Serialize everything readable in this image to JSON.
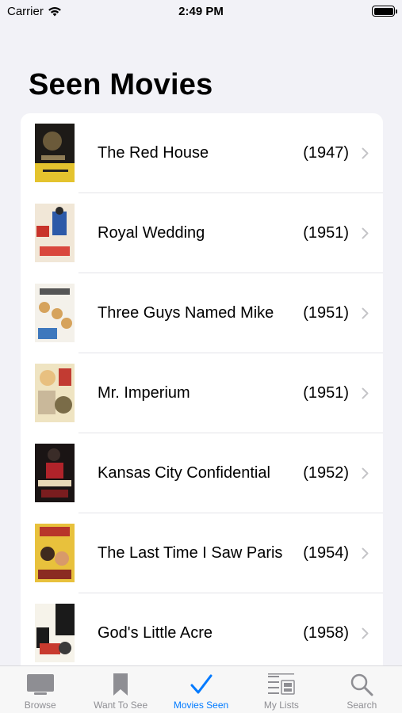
{
  "status_bar": {
    "carrier": "Carrier",
    "time": "2:49 PM"
  },
  "page": {
    "title": "Seen Movies"
  },
  "movies": [
    {
      "title": "The Red House",
      "year": "(1947)",
      "poster_colors": [
        "#1d1a17",
        "#e4c32e",
        "#6b5a3a"
      ]
    },
    {
      "title": "Royal Wedding",
      "year": "(1951)",
      "poster_colors": [
        "#f1e7d7",
        "#c8342b",
        "#2d5aa8"
      ]
    },
    {
      "title": "Three Guys Named Mike",
      "year": "(1951)",
      "poster_colors": [
        "#f4f1ea",
        "#d6a35c",
        "#3e78bd"
      ]
    },
    {
      "title": "Mr. Imperium",
      "year": "(1951)",
      "poster_colors": [
        "#efe4c2",
        "#c23b32",
        "#7a6c48"
      ]
    },
    {
      "title": "Kansas City Confidential",
      "year": "(1952)",
      "poster_colors": [
        "#1a1414",
        "#b0232a",
        "#e8d9b8"
      ]
    },
    {
      "title": "The Last Time I Saw Paris",
      "year": "(1954)",
      "poster_colors": [
        "#e8c13c",
        "#b8352a",
        "#3f2a1e"
      ]
    },
    {
      "title": "God's Little Acre",
      "year": "(1958)",
      "poster_colors": [
        "#f6f3ea",
        "#1a1a1a",
        "#c83a2e"
      ]
    }
  ],
  "tab_bar": {
    "tabs": [
      {
        "label": "Browse",
        "icon": "tv-icon",
        "active": false
      },
      {
        "label": "Want To See",
        "icon": "bookmark-icon",
        "active": false
      },
      {
        "label": "Movies Seen",
        "icon": "checkmark-icon",
        "active": true
      },
      {
        "label": "My Lists",
        "icon": "list-icon",
        "active": false
      },
      {
        "label": "Search",
        "icon": "search-icon",
        "active": false
      }
    ]
  },
  "colors": {
    "accent": "#007aff",
    "inactive": "#8e8e93",
    "chevron": "#c4c4c7"
  }
}
